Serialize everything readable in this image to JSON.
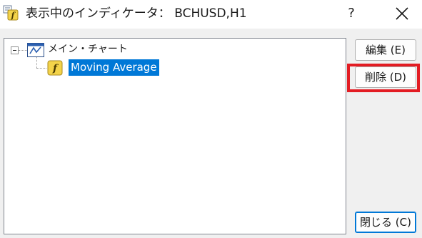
{
  "window": {
    "title": "表示中のインディケータ： BCHUSD,H1",
    "help_label": "?",
    "icons": {
      "app": "indicator-list-icon",
      "close": "close-icon"
    }
  },
  "tree": {
    "root": {
      "label": "メイン・チャート",
      "icon": "chart-window-icon",
      "expanded": true
    },
    "children": [
      {
        "label": "Moving Average",
        "icon": "custom-indicator-icon",
        "selected": true
      }
    ]
  },
  "buttons": {
    "edit_label": "編集 (E)",
    "delete_label": "削除 (D)",
    "close_label": "閉じる (C)"
  },
  "colors": {
    "selection": "#0078d7",
    "highlight_annotation": "#e31c23",
    "indicator_icon": "#f3d34a"
  }
}
